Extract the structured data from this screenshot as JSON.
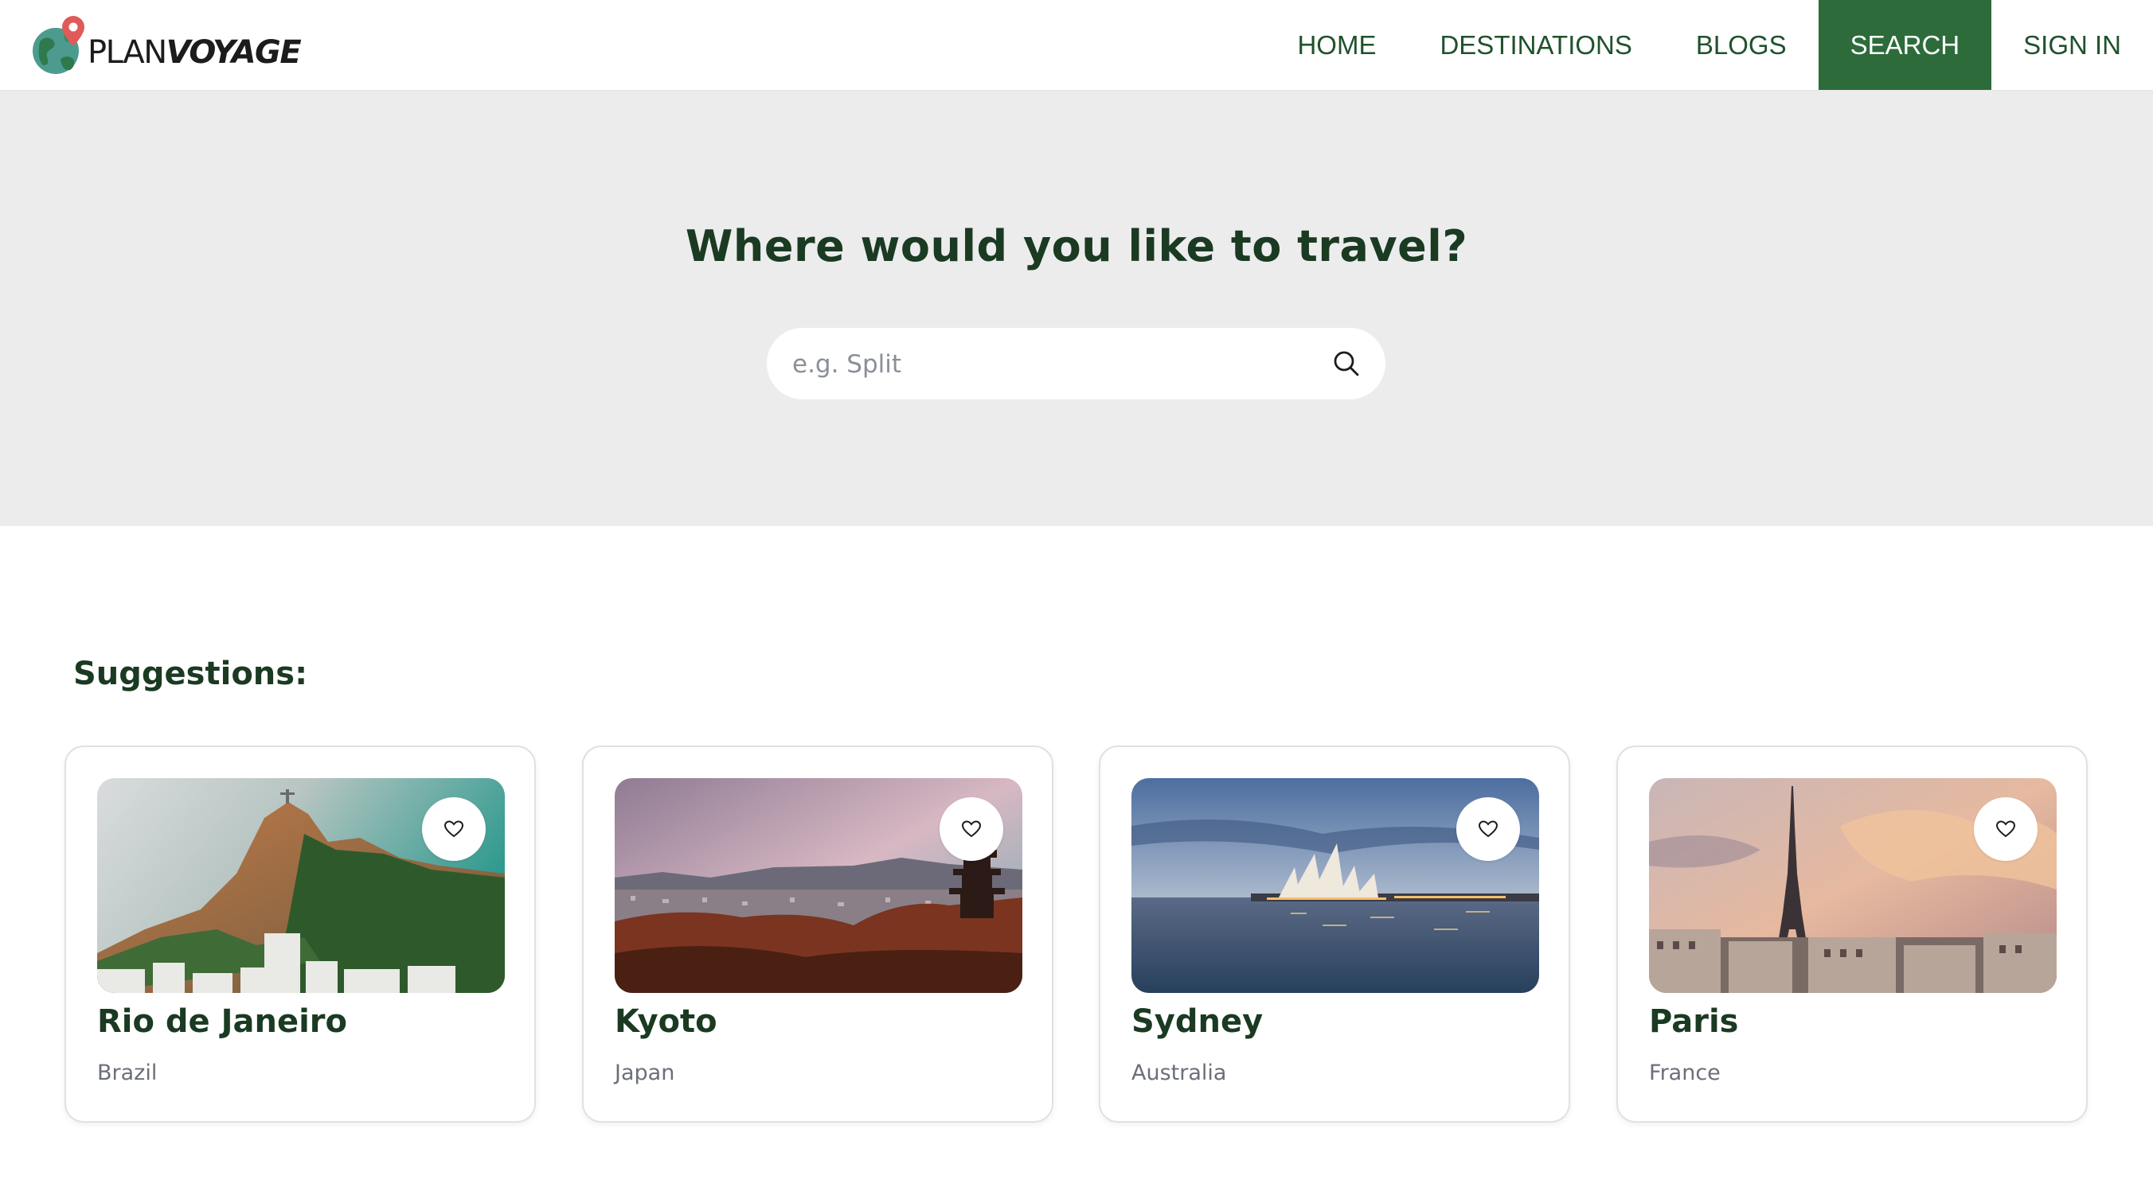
{
  "brand": {
    "part1": "PLAN",
    "part2": "VOYAGE",
    "color": "#2d6b3b"
  },
  "nav": [
    {
      "label": "HOME",
      "active": false
    },
    {
      "label": "DESTINATIONS",
      "active": false
    },
    {
      "label": "BLOGS",
      "active": false
    },
    {
      "label": "SEARCH",
      "active": true
    },
    {
      "label": "SIGN IN",
      "active": false
    }
  ],
  "hero": {
    "title": "Where would you like to travel?",
    "search_placeholder": "e.g. Split",
    "search_value": "",
    "search_icon": "search-icon"
  },
  "suggestions": {
    "title": "Suggestions:",
    "items": [
      {
        "name": "Rio de Janeiro",
        "country": "Brazil",
        "icon": "heart-icon"
      },
      {
        "name": "Kyoto",
        "country": "Japan",
        "icon": "heart-icon"
      },
      {
        "name": "Sydney",
        "country": "Australia",
        "icon": "heart-icon"
      },
      {
        "name": "Paris",
        "country": "France",
        "icon": "heart-icon"
      }
    ]
  }
}
